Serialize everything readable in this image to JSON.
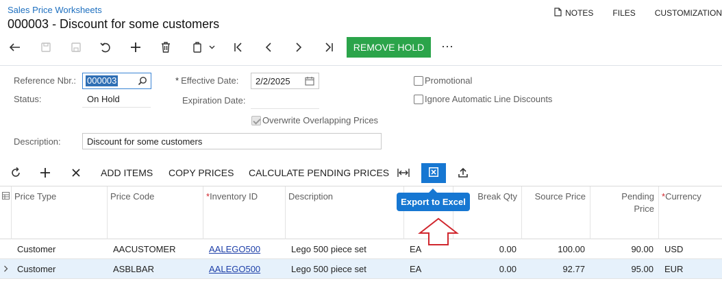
{
  "breadcrumb": "Sales Price Worksheets",
  "title": "000003 - Discount for some customers",
  "top_links": {
    "notes": "NOTES",
    "files": "FILES",
    "customization": "CUSTOMIZATION"
  },
  "toolbar": {
    "icons": [
      "back-icon",
      "save-close-icon",
      "save-icon",
      "undo-icon",
      "add-icon",
      "delete-icon",
      "copy-paste-icon",
      "first-record-icon",
      "previous-record-icon",
      "next-record-icon",
      "last-record-icon"
    ],
    "remove_hold": "REMOVE HOLD",
    "more": "⋯"
  },
  "form": {
    "reference_nbr_label": "Reference Nbr.:",
    "reference_nbr_value": "000003",
    "status_label": "Status:",
    "status_value": "On Hold",
    "effective_date_label": "Effective Date:",
    "effective_date_value": "2/2/2025",
    "expiration_date_label": "Expiration Date:",
    "overwrite_label": "Overwrite Overlapping Prices",
    "overwrite_checked": true,
    "promotional_label": "Promotional",
    "promotional_checked": false,
    "ignore_discounts_label": "Ignore Automatic Line Discounts",
    "ignore_discounts_checked": false,
    "description_label": "Description:",
    "description_value": "Discount for some customers"
  },
  "grid_toolbar": {
    "add_items": "ADD ITEMS",
    "copy_prices": "COPY PRICES",
    "calculate_pending": "CALCULATE PENDING PRICES"
  },
  "tooltip": "Export to Excel",
  "grid": {
    "columns": {
      "price_type": "Price Type",
      "price_code": "Price Code",
      "inventory_id": "Inventory ID",
      "description": "Description",
      "break_qty": "Break Qty",
      "source_price": "Source Price",
      "pending_price_line1": "Pending",
      "pending_price_line2": "Price",
      "currency": "Currency"
    },
    "rows": [
      {
        "price_type": "Customer",
        "price_code": "AACUSTOMER",
        "inventory_id": "AALEGO500",
        "description": "Lego 500 piece set",
        "uom": "EA",
        "break_qty": "0.00",
        "source_price": "100.00",
        "pending_price": "90.00",
        "currency": "USD"
      },
      {
        "price_type": "Customer",
        "price_code": "ASBLBAR",
        "inventory_id": "AALEGO500",
        "description": "Lego 500 piece set",
        "uom": "EA",
        "break_qty": "0.00",
        "source_price": "92.77",
        "pending_price": "95.00",
        "currency": "EUR"
      }
    ]
  },
  "colors": {
    "accent": "#1677d2",
    "success": "#2ba44a",
    "callout": "#d0262d"
  }
}
